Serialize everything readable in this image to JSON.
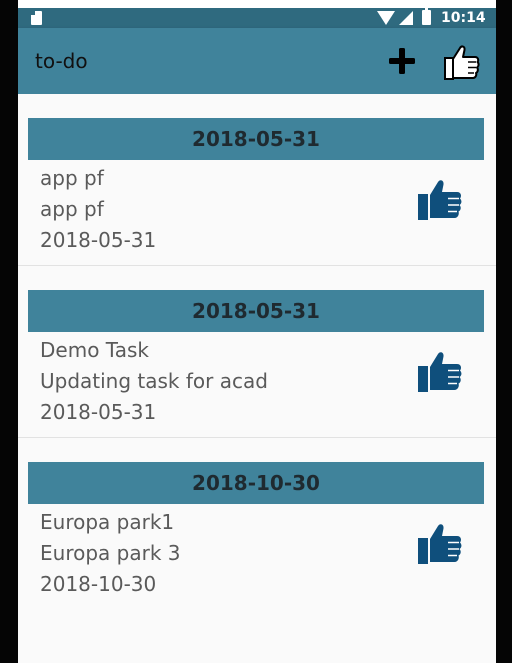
{
  "status_bar": {
    "time": "10:14",
    "icons": [
      "sim-card-icon",
      "wifi-icon",
      "cell-signal-icon",
      "battery-icon"
    ]
  },
  "app_bar": {
    "title": "to-do",
    "actions": [
      {
        "name": "add",
        "icon": "plus-icon"
      },
      {
        "name": "like-all",
        "icon": "thumbs-up-outline-icon"
      }
    ]
  },
  "tasks": [
    {
      "header_date": "2018-05-31",
      "title": "app pf",
      "description": "app pf",
      "date": "2018-05-31",
      "icon": "thumbs-up-icon"
    },
    {
      "header_date": "2018-05-31",
      "title": "Demo Task",
      "description": "Updating task for acad",
      "date": "2018-05-31",
      "icon": "thumbs-up-icon"
    },
    {
      "header_date": "2018-10-30",
      "title": "Europa park1",
      "description": "Europa park 3",
      "date": "2018-10-30",
      "icon": "thumbs-up-icon"
    }
  ],
  "colors": {
    "app_bar": "#40839b",
    "status_bar": "#2f6a7f",
    "card_header": "#40839b",
    "thumb_icon": "#0f4f7c"
  }
}
